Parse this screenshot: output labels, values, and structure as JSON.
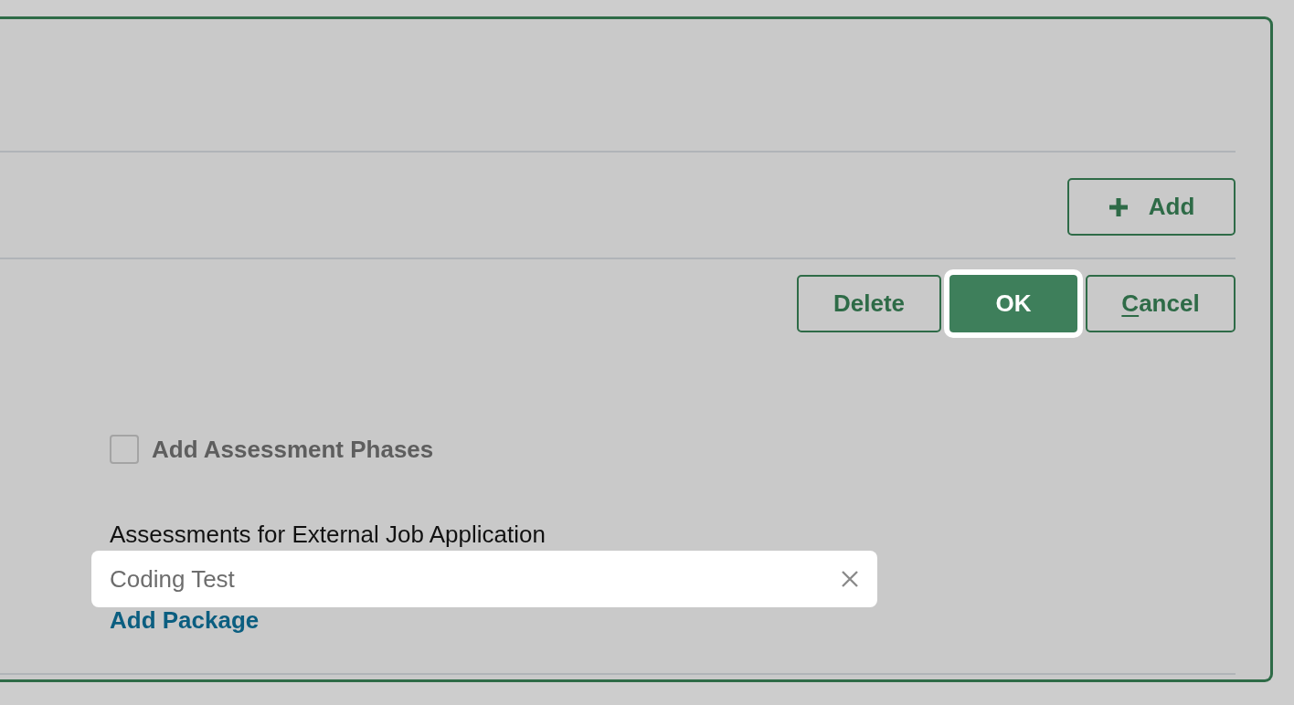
{
  "dialog": {
    "add_button": {
      "label": "Add"
    },
    "actions": [
      {
        "label": "Delete",
        "kind": "outline",
        "underline_first_letter": false
      },
      {
        "label": "OK",
        "kind": "primary",
        "underline_first_letter": false
      },
      {
        "label": "Cancel",
        "kind": "outline",
        "underline_first_letter": true
      }
    ],
    "checkbox": {
      "label": "Add Assessment Phases",
      "checked": false
    },
    "assessments": {
      "label": "Assessments for External Job Application",
      "value": "Coding Test",
      "link": "Add Package"
    }
  }
}
